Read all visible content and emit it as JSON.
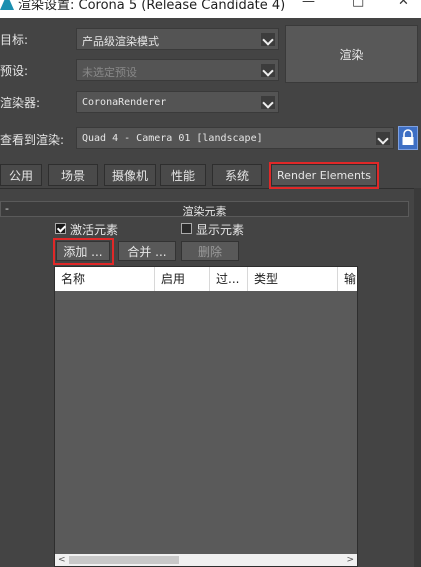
{
  "window": {
    "title": "渲染设置: Corona 5 (Release Candidate 4)",
    "minimize": "—",
    "maximize": "□",
    "close": "✕"
  },
  "settings": {
    "target_label": "目标:",
    "target_value": "产品级渲染模式",
    "preset_label": "预设:",
    "preset_value": "未选定预设",
    "renderer_label": "渲染器:",
    "renderer_value": "CoronaRenderer",
    "view_label": "查看到渲染:",
    "view_value": "Quad 4 - Camera 01 [landscape]",
    "render_button": "渲染"
  },
  "tabs": [
    "公用",
    "场景",
    "摄像机",
    "性能",
    "系统",
    "Render Elements"
  ],
  "active_tab": "Render Elements",
  "rollout": {
    "collapse_symbol": "-",
    "title": "渲染元素",
    "activate_label": "激活元素",
    "activate_checked": true,
    "display_label": "显示元素",
    "display_checked": false,
    "add_button": "添加 ...",
    "merge_button": "合并 ...",
    "delete_button": "删除"
  },
  "list": {
    "columns": [
      "名称",
      "启用",
      "过...",
      "类型",
      "输"
    ],
    "rows": []
  },
  "colors": {
    "highlight_box": "#e02828",
    "lock_button": "#3e6fc4",
    "panel_bg": "#444444"
  },
  "icons": [
    "app-icon",
    "chevron-down-icon",
    "lock-icon",
    "checkbox-icon",
    "scroll-left-icon",
    "scroll-right-icon"
  ]
}
